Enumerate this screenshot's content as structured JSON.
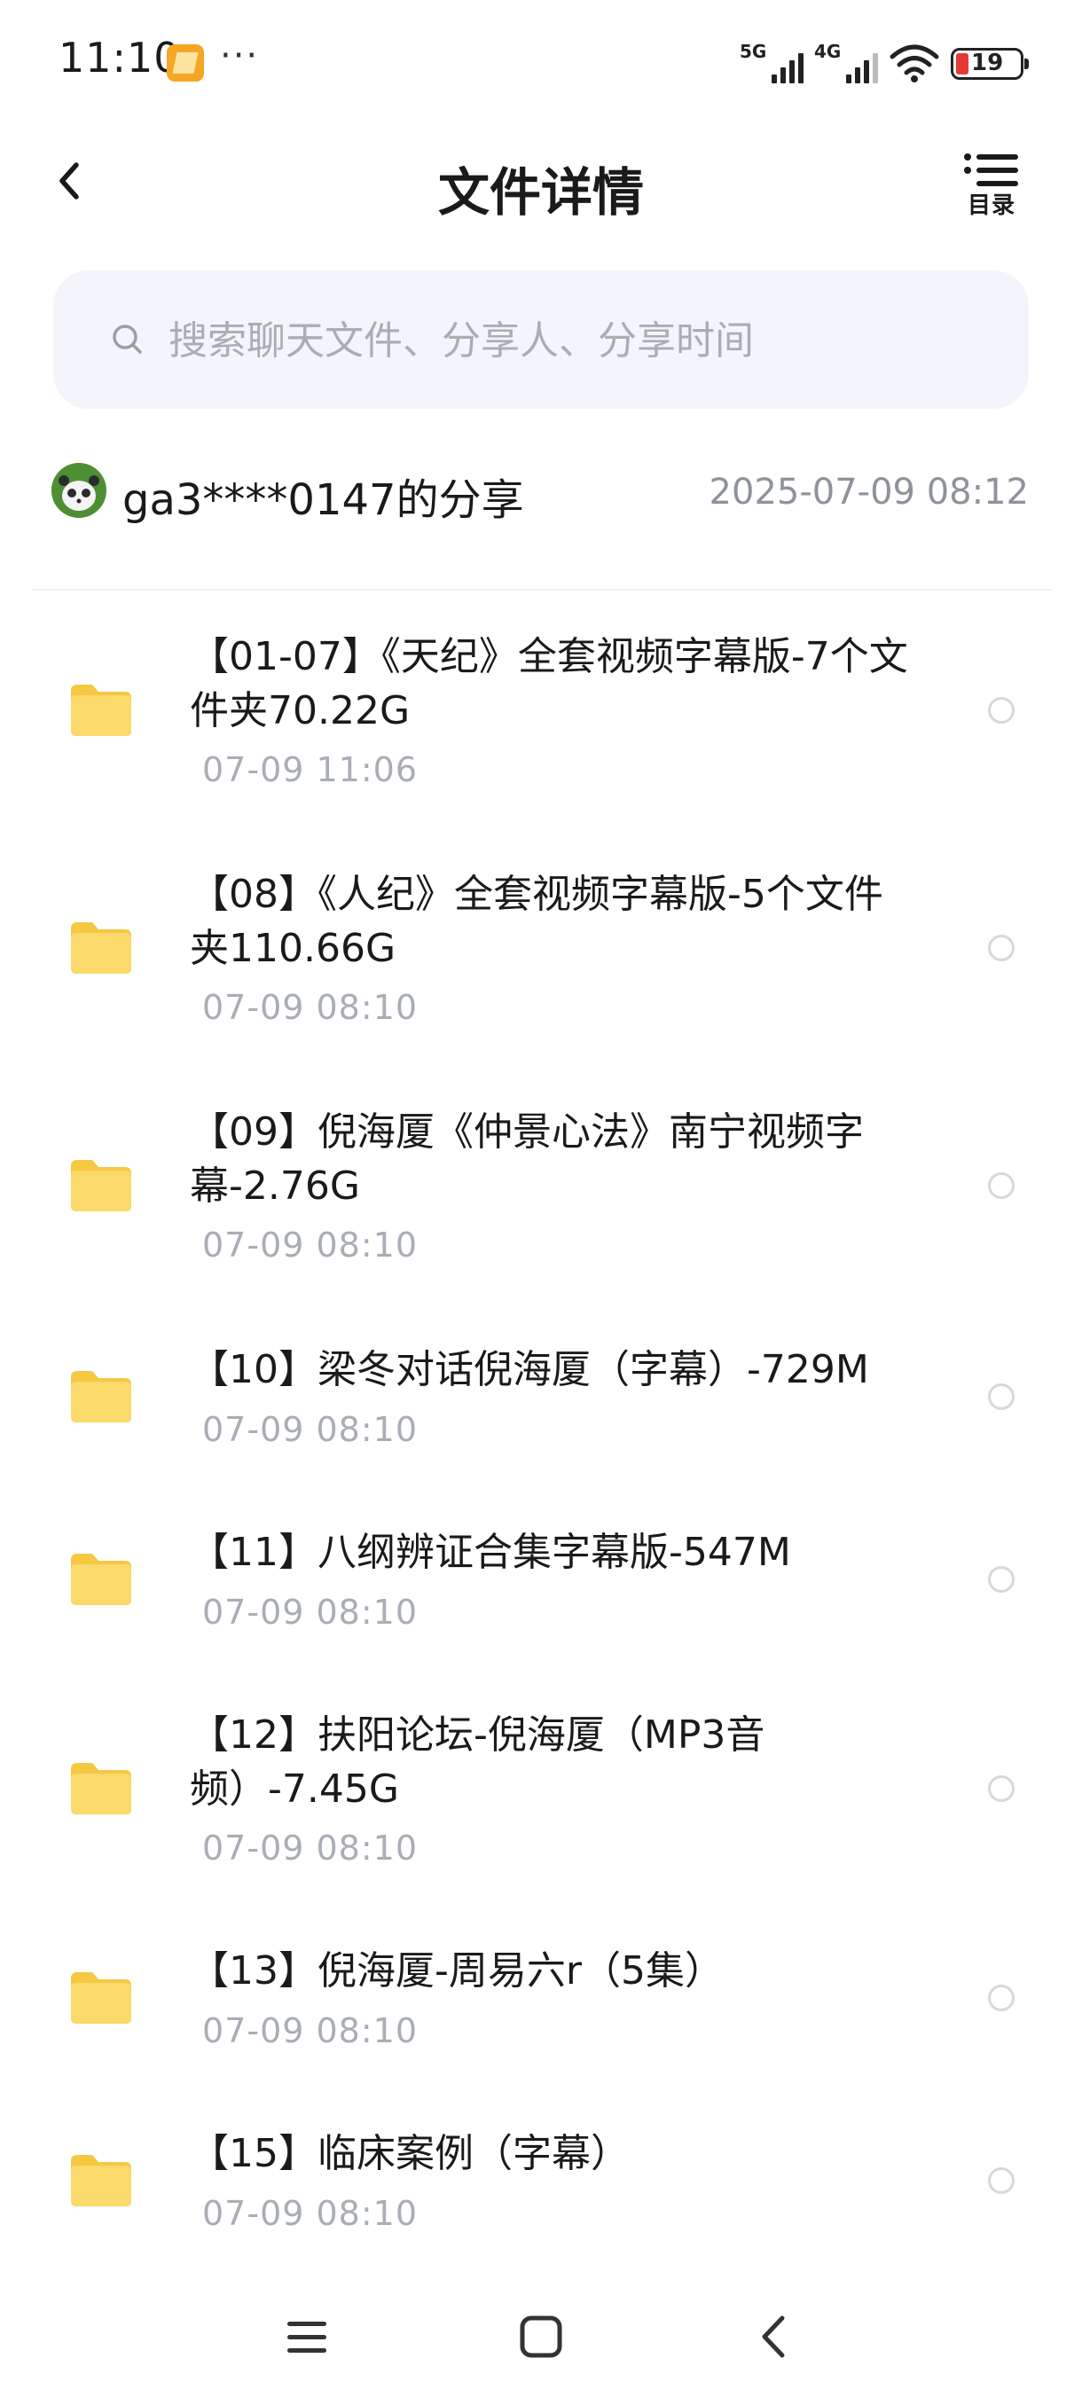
{
  "status_bar": {
    "time": "11:10",
    "app_icon": "note-icon",
    "more": "···",
    "signal_1_label": "5G",
    "signal_2_label": "4G",
    "battery_level": 19
  },
  "header": {
    "title": "文件详情",
    "back_icon": "chevron-left-icon",
    "catalog_label": "目录"
  },
  "search": {
    "placeholder": "搜索聊天文件、分享人、分享时间"
  },
  "share": {
    "user": "ga3****0147的分享",
    "time": "2025-07-09  08:12"
  },
  "files": [
    {
      "name": "【01-07】《天纪》全套视频字幕版-7个文件夹70.22G",
      "time": "07-09  11:06"
    },
    {
      "name": "【08】《人纪》全套视频字幕版-5个文件夹110.66G",
      "time": "07-09  08:10"
    },
    {
      "name": "【09】倪海厦《仲景心法》南宁视频字幕-2.76G",
      "time": "07-09  08:10"
    },
    {
      "name": "【10】梁冬对话倪海厦（字幕）-729M",
      "time": "07-09  08:10"
    },
    {
      "name": "【11】八纲辨证合集字幕版-547M",
      "time": "07-09  08:10"
    },
    {
      "name": "【12】扶阳论坛-倪海厦（MP3音频）-7.45G",
      "time": "07-09  08:10"
    },
    {
      "name": "【13】倪海厦-周易六r（5集）",
      "time": "07-09  08:10"
    },
    {
      "name": "【15】临床案例（字幕）",
      "time": "07-09  08:10"
    }
  ],
  "colors": {
    "folder": "#fbd96a",
    "folder_tab": "#f5c842",
    "search_bg": "#f3f5fa",
    "muted_text": "#a9adb5",
    "battery_low": "#e53935"
  },
  "nav_bar": {
    "menu_icon": "menu-icon",
    "home_icon": "home-square-icon",
    "back_icon": "back-chevron-icon"
  }
}
